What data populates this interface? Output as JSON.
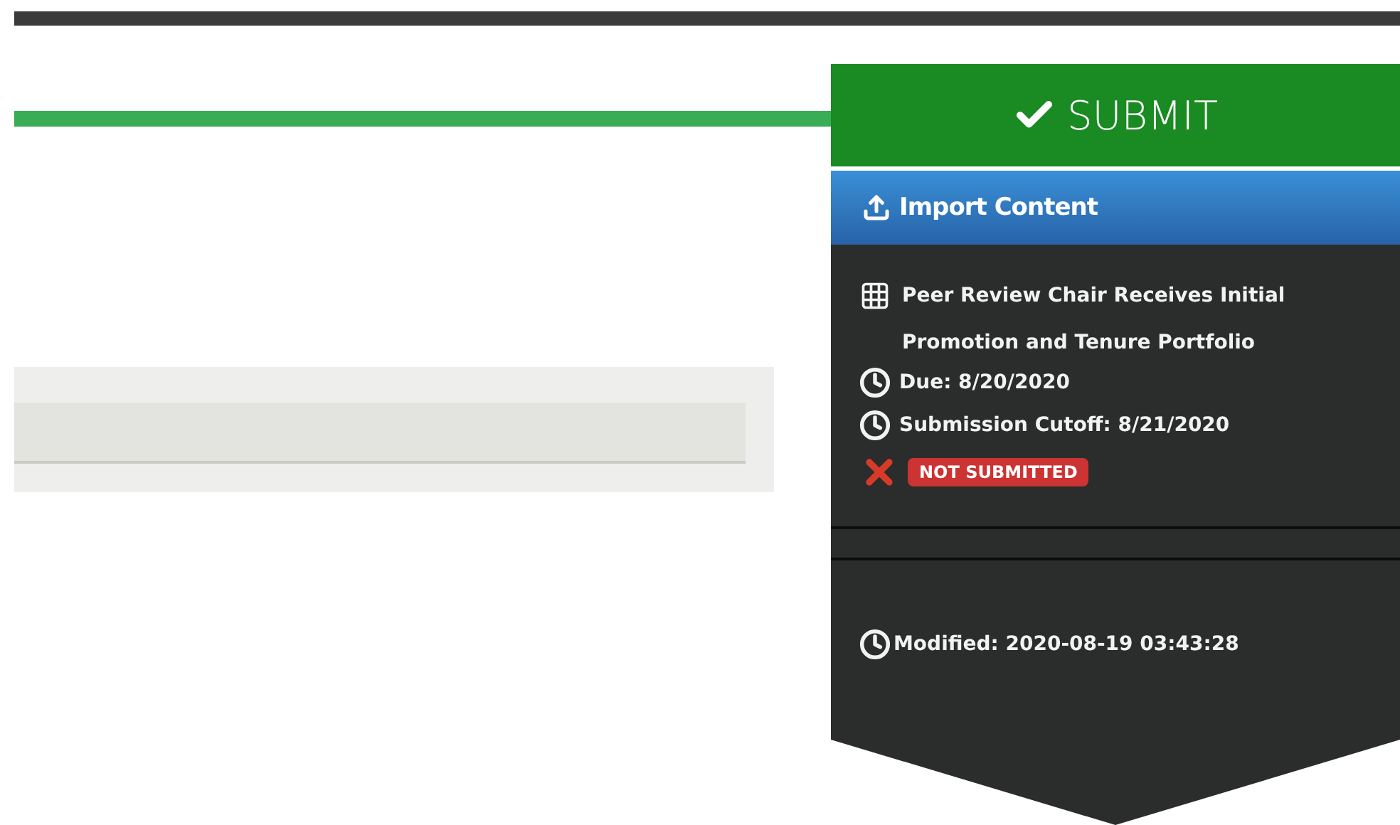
{
  "submit_button": {
    "label": "SUBMIT"
  },
  "import_button": {
    "label": "Import Content"
  },
  "task": {
    "title": "Peer Review Chair Receives Initial Promotion and Tenure Portfolio",
    "dates": [
      {
        "label": "Due: 8/20/2020"
      },
      {
        "label": "Submission Cutoff: 8/21/2020"
      }
    ],
    "status": {
      "kind": "not_submitted",
      "label": "NOT SUBMITTED"
    },
    "modified": "Modified: 2020-08-19 03:43:28"
  }
}
